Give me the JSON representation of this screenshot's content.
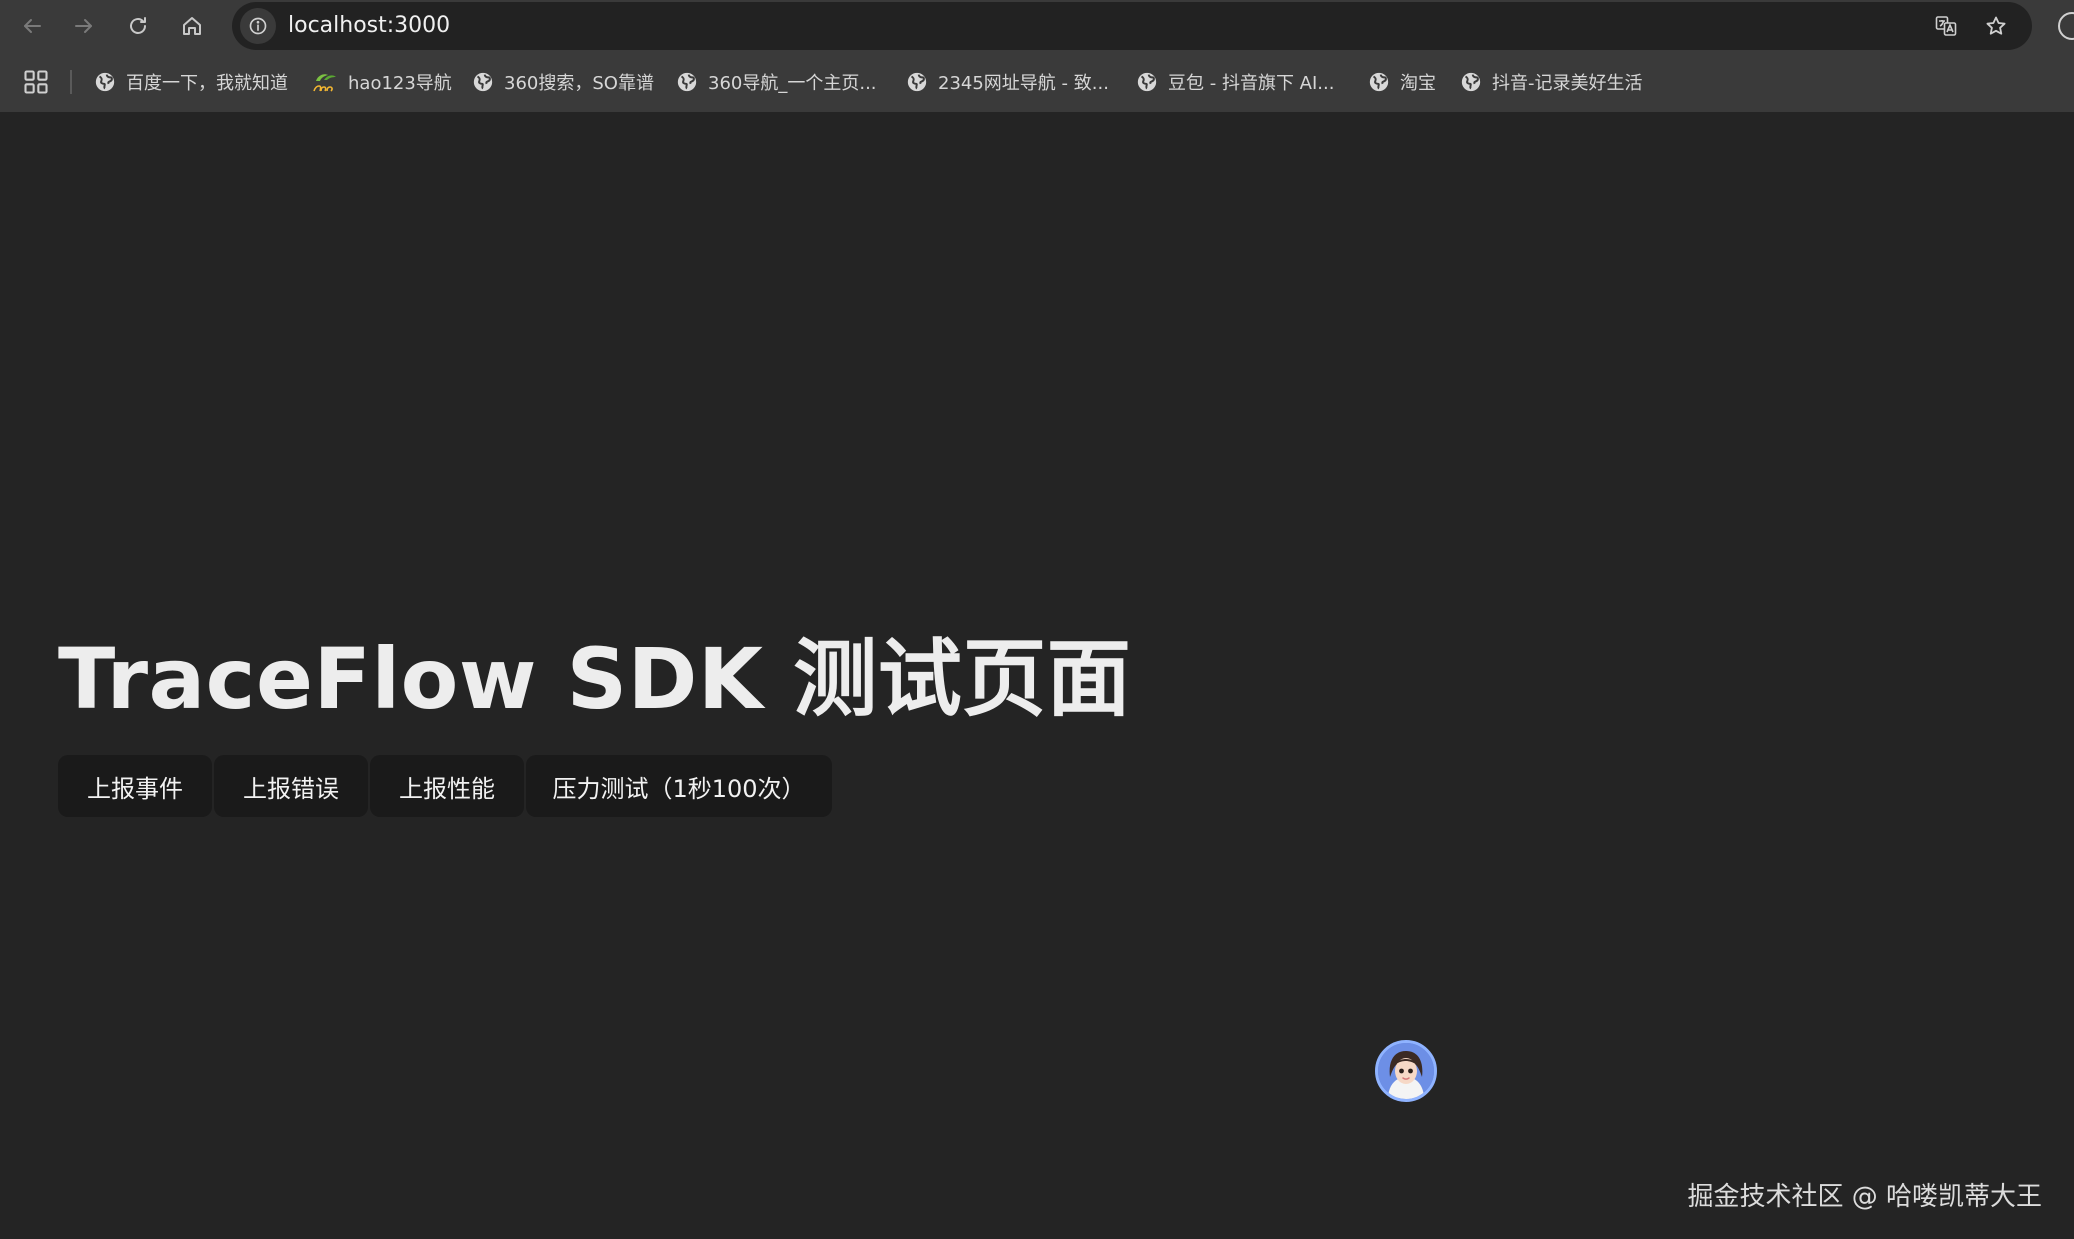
{
  "browser": {
    "toolbar": {
      "back_icon": "arrow-left-icon",
      "forward_icon": "arrow-right-icon",
      "reload_icon": "reload-icon",
      "home_icon": "home-icon"
    },
    "omnibox": {
      "url": "localhost:3000",
      "site_info_icon": "info-icon",
      "translate_icon": "translate-icon",
      "bookmark_star_icon": "star-icon"
    },
    "bookmarks": [
      {
        "label": "百度一下，我就知道",
        "icon": "globe-icon"
      },
      {
        "label": "hao123导航",
        "icon": "hao123-logo-icon"
      },
      {
        "label": "360搜索，SO靠谱",
        "icon": "globe-icon"
      },
      {
        "label": "360导航_一个主页...",
        "icon": "globe-icon"
      },
      {
        "label": "2345网址导航 - 致...",
        "icon": "globe-icon"
      },
      {
        "label": "豆包 - 抖音旗下 AI...",
        "icon": "globe-icon"
      },
      {
        "label": "淘宝",
        "icon": "globe-icon"
      },
      {
        "label": "抖音-记录美好生活",
        "icon": "globe-icon"
      }
    ]
  },
  "page": {
    "title": "TraceFlow SDK 测试页面",
    "buttons": [
      {
        "label": "上报事件"
      },
      {
        "label": "上报错误"
      },
      {
        "label": "上报性能"
      },
      {
        "label": "压力测试（1秒100次）"
      }
    ],
    "floating_avatar": "assistant-avatar-icon"
  },
  "watermark": "掘金技术社区 @ 哈喽凯蒂大王",
  "colors": {
    "page_background": "#242424",
    "browser_chrome": "#3a3a3a",
    "button_background": "#1a1a1a",
    "text": "#ededed"
  }
}
